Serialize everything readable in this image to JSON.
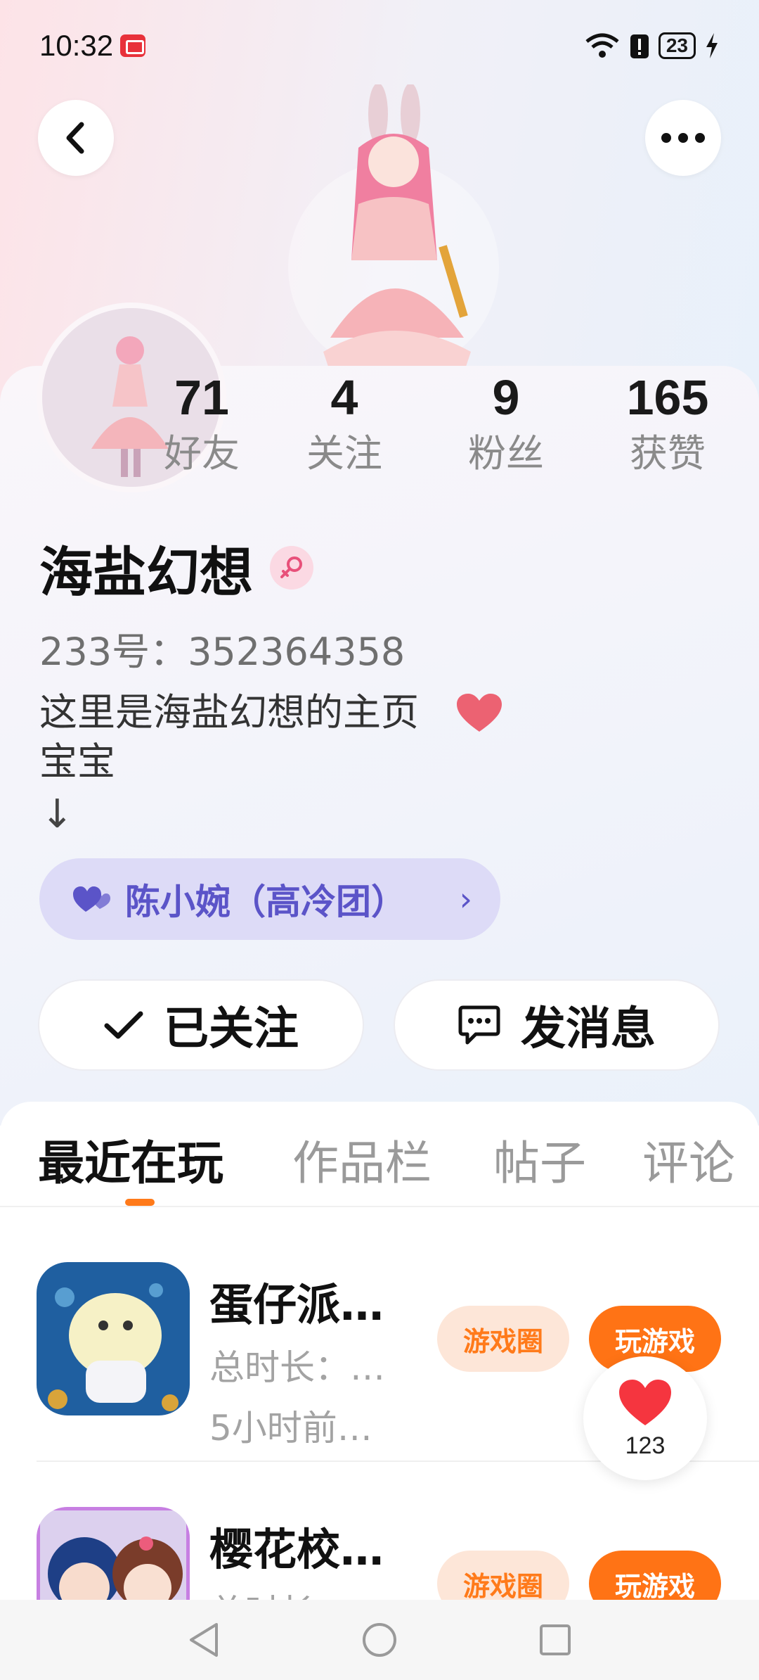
{
  "status_bar": {
    "time": "10:32",
    "battery": "23"
  },
  "header": {
    "back_icon": "chevron-left-icon",
    "more_icon": "more-dots-icon"
  },
  "profile": {
    "stats": [
      {
        "value": "71",
        "label": "好友"
      },
      {
        "value": "4",
        "label": "关注"
      },
      {
        "value": "9",
        "label": "粉丝"
      },
      {
        "value": "165",
        "label": "获赞"
      }
    ],
    "name": "海盐幻想",
    "uid": "233号：352364358",
    "bio": "这里是海盐幻想的主页\n宝宝",
    "bio_arrow": "↓",
    "tag": "陈小婉（高冷团）",
    "tag_chevron": "›"
  },
  "actions": {
    "follow_label": "已关注",
    "message_label": "发消息"
  },
  "tabs": [
    {
      "label": "最近在玩",
      "active": true
    },
    {
      "label": "作品栏",
      "active": false
    },
    {
      "label": "帖子",
      "active": false
    },
    {
      "label": "评论",
      "active": false
    }
  ],
  "games": [
    {
      "name": "蛋仔派…",
      "duration": "总时长：…",
      "last_played": "5小时前…",
      "circle_label": "游戏圈",
      "play_label": "玩游戏"
    },
    {
      "name": "樱花校…",
      "duration": "总时长：",
      "last_played": "",
      "circle_label": "游戏圈",
      "play_label": "玩游戏"
    }
  ],
  "like_button": {
    "count": "123"
  },
  "colors": {
    "accent": "#ff7315",
    "tag_bg": "#dddbf7",
    "tag_text": "#5b54c8"
  }
}
